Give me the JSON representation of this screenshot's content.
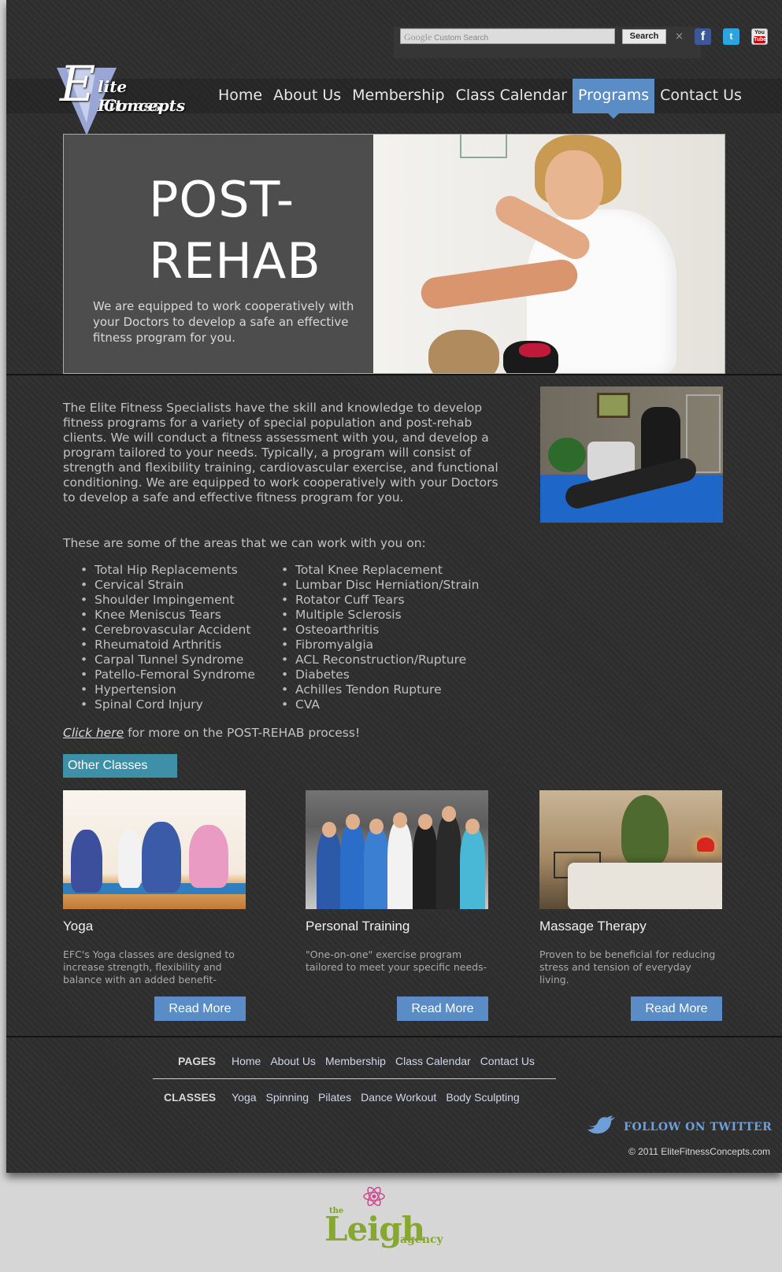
{
  "search": {
    "placeholder_brand": "Google",
    "placeholder": "Custom Search",
    "button": "Search",
    "clear": "×"
  },
  "social": {
    "facebook": "f",
    "twitter": "t",
    "youtube_top": "You",
    "youtube_bottom": "Tube"
  },
  "logo": {
    "initial": "E",
    "line1": "lite Fitness",
    "line2": "Concepts"
  },
  "nav": {
    "items": [
      "Home",
      "About Us",
      "Membership",
      "Class Calendar",
      "Programs",
      "Contact Us"
    ],
    "active": "Programs"
  },
  "hero": {
    "title_line1": "POST-",
    "title_line2": "REHAB",
    "description": "We are equipped to work cooperatively with your Doctors to develop a safe an effective fitness program for you."
  },
  "intro": {
    "paragraph": "The Elite Fitness Specialists have the skill and knowledge to develop fitness programs for a variety of special population and post-rehab clients. We will conduct a fitness assessment with you, and develop a program tailored to your needs. Typically, a program will consist of strength and flexibility training, cardiovascular exercise, and functional conditioning. We are equipped to work cooperatively with your Doctors to develop a safe and effective fitness program for you.",
    "areas_lead": "These are some of the areas that we can work with you on:",
    "areas_left": [
      "Total Hip Replacements",
      "Cervical Strain",
      "Shoulder Impingement",
      "Knee Meniscus Tears",
      "Cerebrovascular Accident",
      "Rheumatoid Arthritis",
      "Carpal Tunnel Syndrome",
      "Patello-Femoral Syndrome",
      "Hypertension",
      "Spinal Cord Injury"
    ],
    "areas_right": [
      "Total Knee Replacement",
      "Lumbar Disc Herniation/Strain",
      "Rotator Cuff Tears",
      "Multiple Sclerosis",
      "Osteoarthritis",
      "Fibromyalgia",
      "ACL Reconstruction/Rupture",
      "Diabetes",
      "Achilles Tendon Rupture",
      "CVA"
    ],
    "click_link": "Click here",
    "click_rest": " for more on the POST-REHAB process!"
  },
  "other_classes": {
    "heading": "Other Classes",
    "cards": [
      {
        "title": "Yoga",
        "description": "EFC's Yoga classes are designed to increase strength, flexibility and balance with an added benefit-",
        "button": "Read More"
      },
      {
        "title": "Personal Training",
        "description": "\"One-on-one\" exercise program tailored to meet your specific needs-",
        "button": "Read More"
      },
      {
        "title": "Massage Therapy",
        "description": "Proven to be beneficial for reducing stress and tension of everyday living.",
        "button": "Read More"
      }
    ]
  },
  "footer": {
    "pages_label": "PAGES",
    "pages": [
      "Home",
      "About Us",
      "Membership",
      "Class Calendar",
      "Contact Us"
    ],
    "classes_label": "CLASSES",
    "classes": [
      "Yoga",
      "Spinning",
      "Pilates",
      "Dance Workout",
      "Body Sculpting"
    ],
    "follow": "FOLLOW ON TWITTER",
    "copyright": "© 2011 EliteFitnessConcepts.com"
  },
  "credit": {
    "the": "the",
    "name": "Leigh",
    "agency": "agency"
  },
  "colors": {
    "accent_blue": "#5a8cc6",
    "tab_teal": "#3e8fa8",
    "background": "#2e2e2e"
  }
}
